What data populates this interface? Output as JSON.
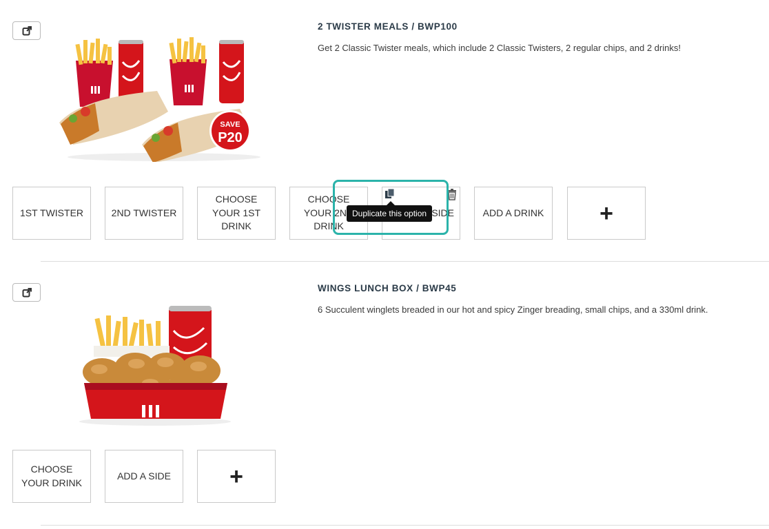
{
  "items": [
    {
      "title": "2 TWISTER MEALS / BWP100",
      "description": "Get 2 Classic Twister meals, which include 2 Classic Twisters, 2 regular chips, and 2 drinks!",
      "image_badge": {
        "line1": "SAVE",
        "line2": "P20"
      },
      "options": [
        "1ST TWISTER",
        "2ND TWISTER",
        "CHOOSE YOUR 1ST DRINK",
        "CHOOSE YOUR 2ND DRINK",
        "ADD A SIDE",
        "ADD A DRINK"
      ],
      "add_option_icon": "plus-icon"
    },
    {
      "title": "WINGS LUNCH BOX / BWP45",
      "description": "6 Succulent winglets breaded in our hot and spicy Zinger breading, small chips, and a 330ml drink.",
      "options": [
        "CHOOSE YOUR DRINK",
        "ADD A SIDE"
      ],
      "add_option_icon": "plus-icon"
    }
  ],
  "tooltip": {
    "text": "Duplicate this option"
  },
  "colors": {
    "highlight": "#2bb3aa",
    "title": "#2b3b48",
    "kfc_red": "#c8102e",
    "tooltip_bg": "#111111"
  },
  "icons": {
    "external": "external-link-icon",
    "duplicate": "duplicate-icon",
    "delete": "trash-icon"
  }
}
